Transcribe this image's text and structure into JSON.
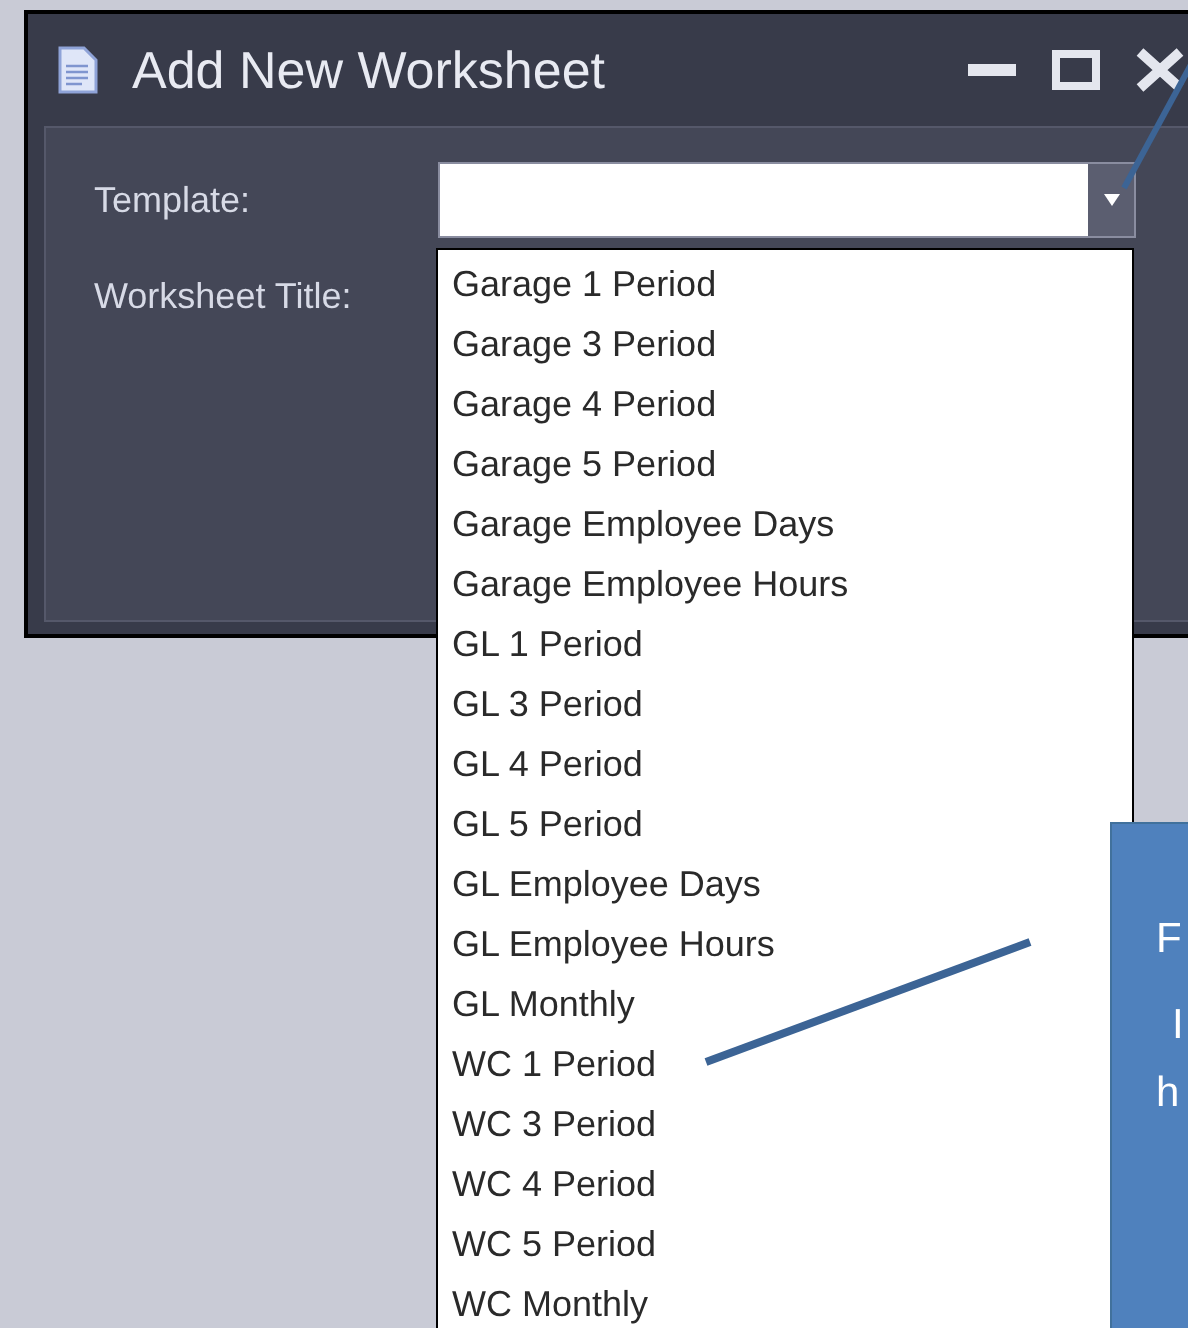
{
  "window": {
    "title": "Add New Worksheet"
  },
  "fields": [
    {
      "label": "Template:",
      "kind": "combo"
    },
    {
      "label": "Worksheet Title:",
      "kind": "text"
    }
  ],
  "dropdown": {
    "items": [
      "Garage 1 Period",
      "Garage 3 Period",
      "Garage 4 Period",
      "Garage 5 Period",
      "Garage Employee Days",
      "Garage Employee Hours",
      "GL 1 Period",
      "GL 3 Period",
      "GL 4 Period",
      "GL 5 Period",
      "GL Employee Days",
      "GL Employee Hours",
      "GL Monthly",
      "WC 1 Period",
      "WC 3 Period",
      "WC 4 Period",
      "WC 5 Period",
      "WC Monthly"
    ]
  },
  "callout": {
    "lines": [
      "F",
      "I",
      "h"
    ]
  }
}
